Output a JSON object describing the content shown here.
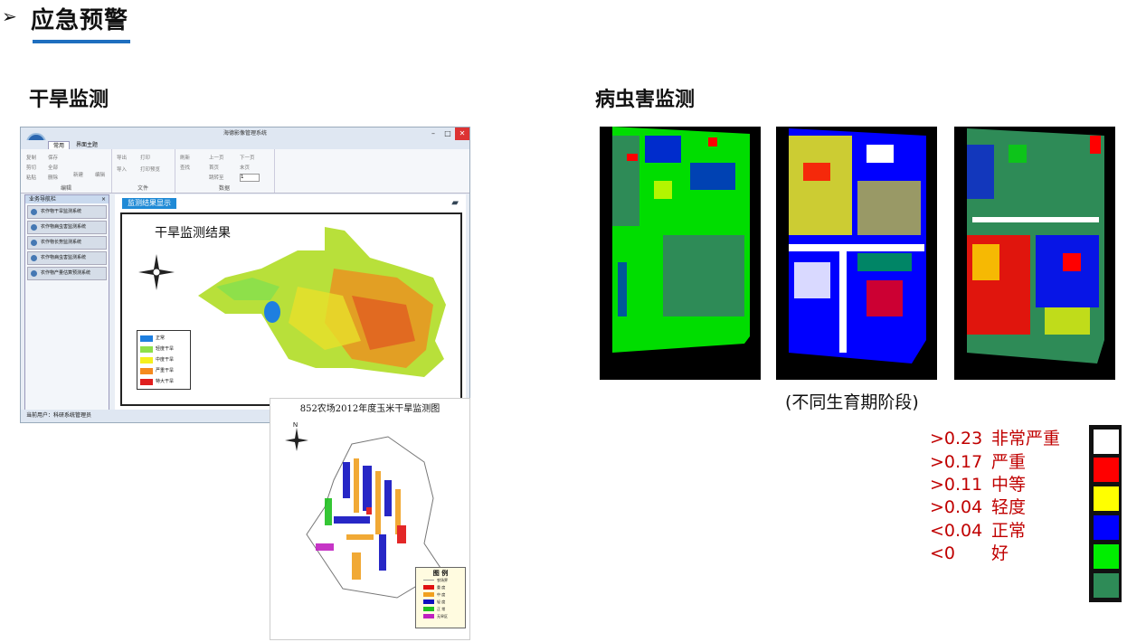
{
  "heading": "应急预警",
  "drought": {
    "title": "干旱监测",
    "window": {
      "title": "海德影像管理系统",
      "tabs": [
        "常用",
        "界面主题"
      ],
      "groups": [
        "编辑",
        "文件",
        "数据"
      ],
      "ribbon_items": [
        "复制",
        "保存",
        "导出",
        "打印",
        "刷新",
        "上一页",
        "下一页",
        "剪切",
        "全部",
        "导入",
        "打印预览",
        "查找",
        "首页",
        "末页",
        "粘贴",
        "删除",
        "新建",
        "编辑",
        "跳转至"
      ],
      "page_input": "1",
      "nav_title": "业务导航栏",
      "nav_items": [
        "农作物干旱监测系统",
        "农作物病虫害监测系统",
        "农作物长势监测系统",
        "农作物病虫害监测系统",
        "农作物产量估算预测系统"
      ],
      "result_button": "监测结果显示",
      "map_title": "干旱监测结果",
      "legend": [
        {
          "label": "正常",
          "color": "#1e7fe0"
        },
        {
          "label": "轻度干旱",
          "color": "#8ee04a"
        },
        {
          "label": "中度干旱",
          "color": "#f5f01e"
        },
        {
          "label": "严重干旱",
          "color": "#f58a1e"
        },
        {
          "label": "特大干旱",
          "color": "#e01e1e"
        }
      ],
      "status": "当前用户：科研系统管理员"
    },
    "map2": {
      "title": "852农场2012年度玉米干旱监测图",
      "legend_title": "图  例",
      "legend": [
        {
          "label": "农场界",
          "color": "#999999"
        },
        {
          "label": "重 度",
          "color": "#e01010"
        },
        {
          "label": "中 度",
          "color": "#f0a020"
        },
        {
          "label": "轻 度",
          "color": "#1010c0"
        },
        {
          "label": "正 常",
          "color": "#20c020"
        },
        {
          "label": "无旱区",
          "color": "#c020c0"
        }
      ]
    }
  },
  "pest": {
    "title": "病虫害监测",
    "caption": "(不同生育期阶段)",
    "thresholds": [
      {
        "value": ">0.23",
        "label": "非常严重",
        "color": "#ffffff"
      },
      {
        "value": ">0.17",
        "label": "严重",
        "color": "#ff0000"
      },
      {
        "value": ">0.11",
        "label": "中等",
        "color": "#ffff00"
      },
      {
        "value": ">0.04",
        "label": "轻度",
        "color": "#0000ff"
      },
      {
        "value": "<0.04",
        "label": "正常",
        "color": "#00ee00"
      },
      {
        "value": "<0",
        "label": "好",
        "color": "#2e8b57"
      }
    ]
  }
}
